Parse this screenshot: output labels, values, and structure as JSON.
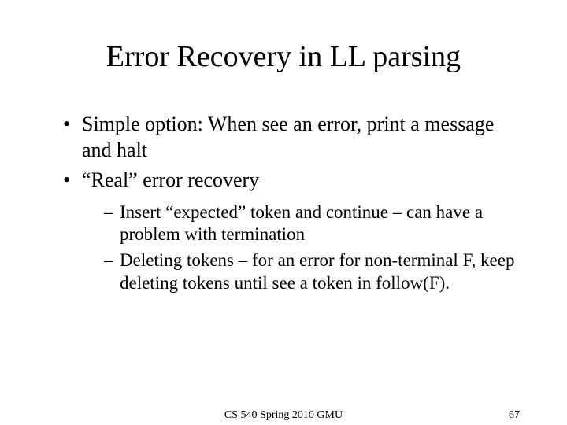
{
  "title": "Error Recovery in LL parsing",
  "bullets": [
    "Simple option: When see an error, print a message and halt",
    "“Real” error recovery"
  ],
  "sub": [
    "Insert “expected” token and continue – can have a problem with termination",
    "Deleting tokens – for an error for non-terminal F, keep deleting tokens until see a token in follow(F)."
  ],
  "footer": {
    "center": "CS 540 Spring 2010 GMU",
    "page": "67"
  }
}
